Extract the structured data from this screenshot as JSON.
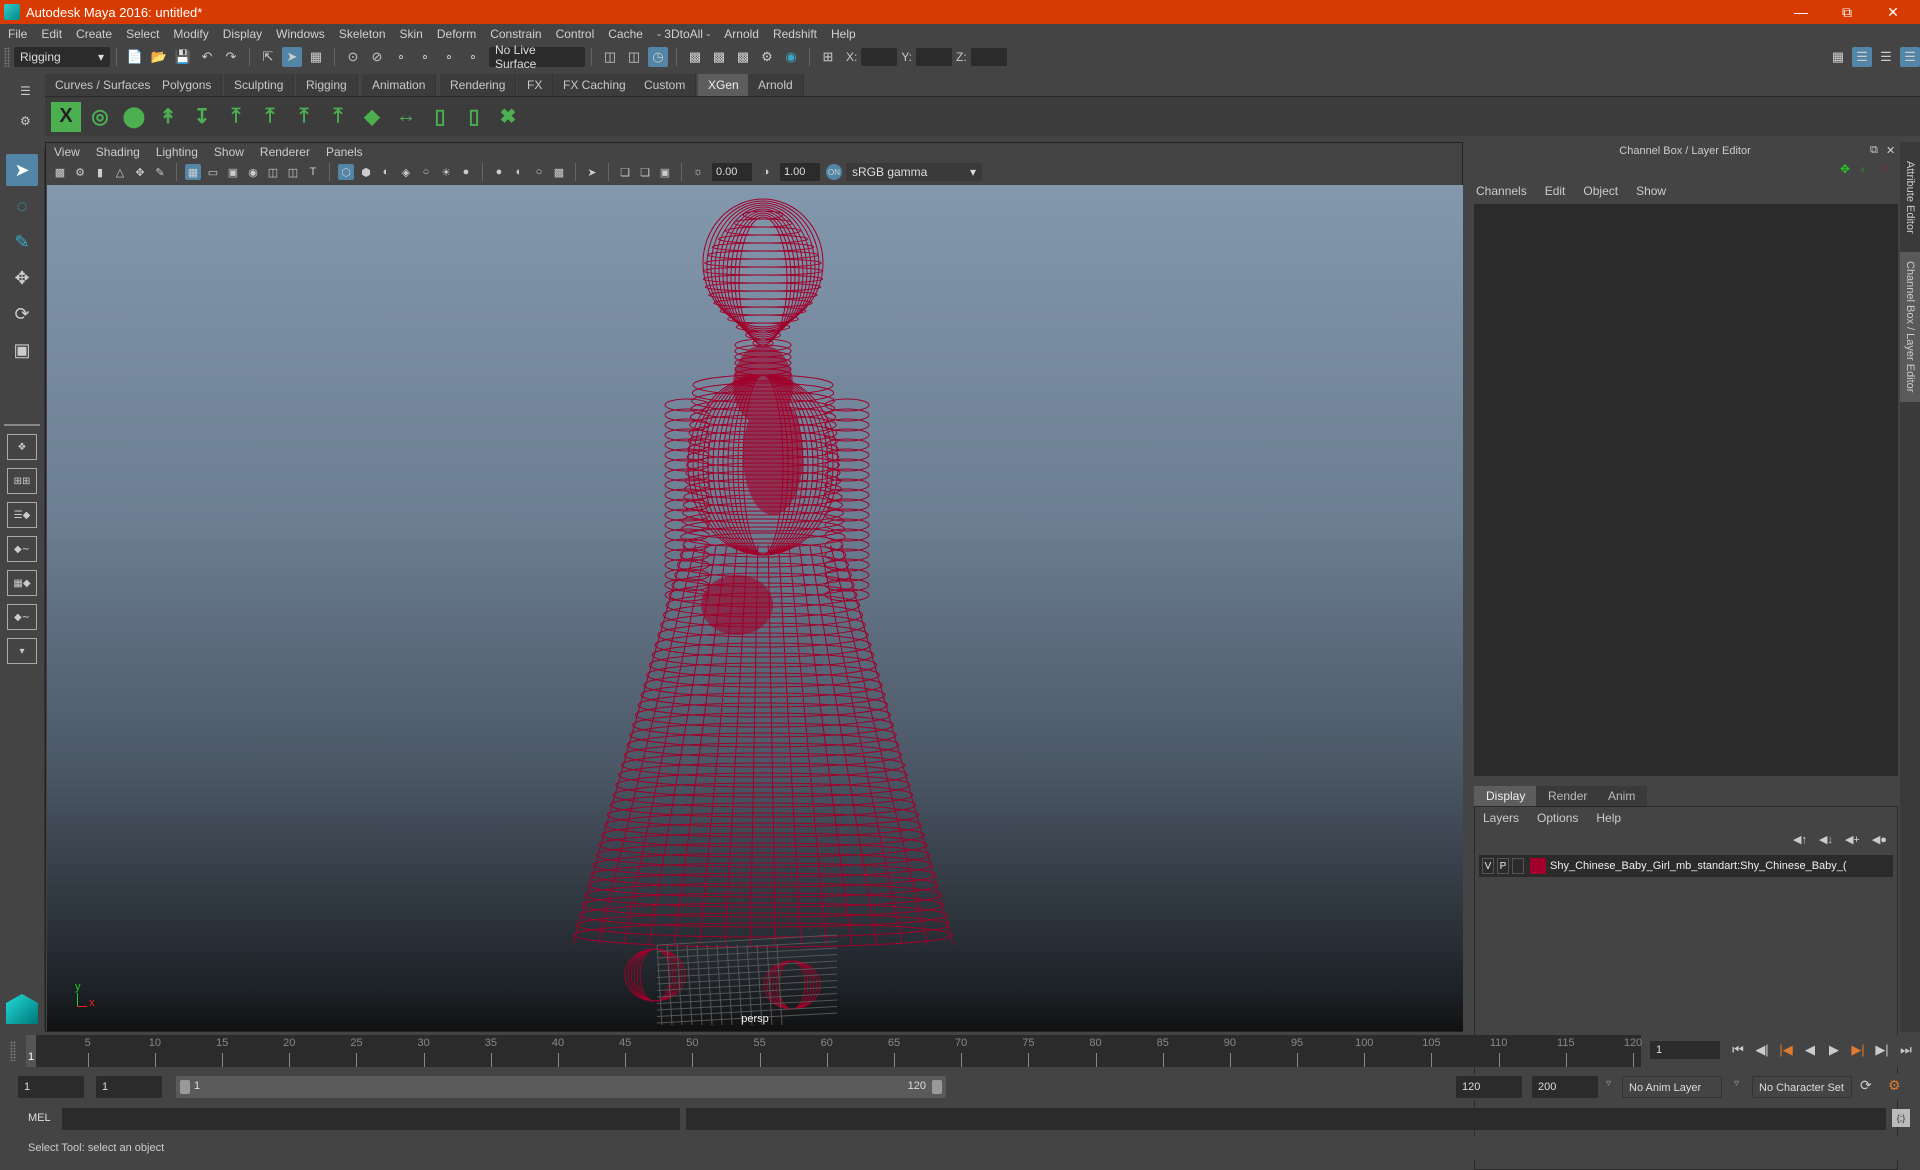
{
  "window": {
    "title": "Autodesk Maya 2016: untitled*"
  },
  "menubar": [
    "File",
    "Edit",
    "Create",
    "Select",
    "Modify",
    "Display",
    "Windows",
    "Skeleton",
    "Skin",
    "Deform",
    "Constrain",
    "Control",
    "Cache",
    "- 3DtoAll -",
    "Arnold",
    "Redshift",
    "Help"
  ],
  "statusline": {
    "menu_set": "Rigging",
    "live_surface": "No Live Surface",
    "x_label": "X:",
    "y_label": "Y:",
    "z_label": "Z:"
  },
  "shelf": {
    "tabs": [
      "Curves / Surfaces",
      "Polygons",
      "Sculpting",
      "Rigging",
      "Animation",
      "Rendering",
      "FX",
      "FX Caching",
      "Custom",
      "XGen",
      "Arnold"
    ],
    "active_tab": "XGen"
  },
  "viewport": {
    "menu": [
      "View",
      "Shading",
      "Lighting",
      "Show",
      "Renderer",
      "Panels"
    ],
    "exposure": "0.00",
    "gamma": "1.00",
    "color_space": "sRGB gamma",
    "camera_label": "persp",
    "wireframe_color": "#a0002a",
    "axis": {
      "x": "x",
      "y": "y"
    }
  },
  "channel_box": {
    "title": "Channel Box / Layer Editor",
    "menu": [
      "Channels",
      "Edit",
      "Object",
      "Show"
    ],
    "layer_tabs": [
      "Display",
      "Render",
      "Anim"
    ],
    "active_layer_tab": "Display",
    "layer_menu": [
      "Layers",
      "Options",
      "Help"
    ],
    "layers": [
      {
        "v": "V",
        "p": "P",
        "color": "#a0002a",
        "name": "Shy_Chinese_Baby_Girl_mb_standart:Shy_Chinese_Baby_("
      }
    ]
  },
  "side_tabs": [
    "Attribute Editor",
    "Channel Box / Layer Editor"
  ],
  "timeline": {
    "ticks": [
      1,
      5,
      10,
      15,
      20,
      25,
      30,
      35,
      40,
      45,
      50,
      55,
      60,
      65,
      70,
      75,
      80,
      85,
      90,
      95,
      100,
      105,
      110,
      115,
      120
    ],
    "current_frame": "1",
    "current_frame_field": "1"
  },
  "range": {
    "start": "1",
    "playback_start": "1",
    "range_min_label": "1",
    "range_max_label": "120",
    "playback_end": "120",
    "end": "200",
    "anim_layer": "No Anim Layer",
    "character_set": "No Character Set"
  },
  "command_line": {
    "label": "MEL"
  },
  "status": {
    "help_text": "Select Tool: select an object"
  }
}
